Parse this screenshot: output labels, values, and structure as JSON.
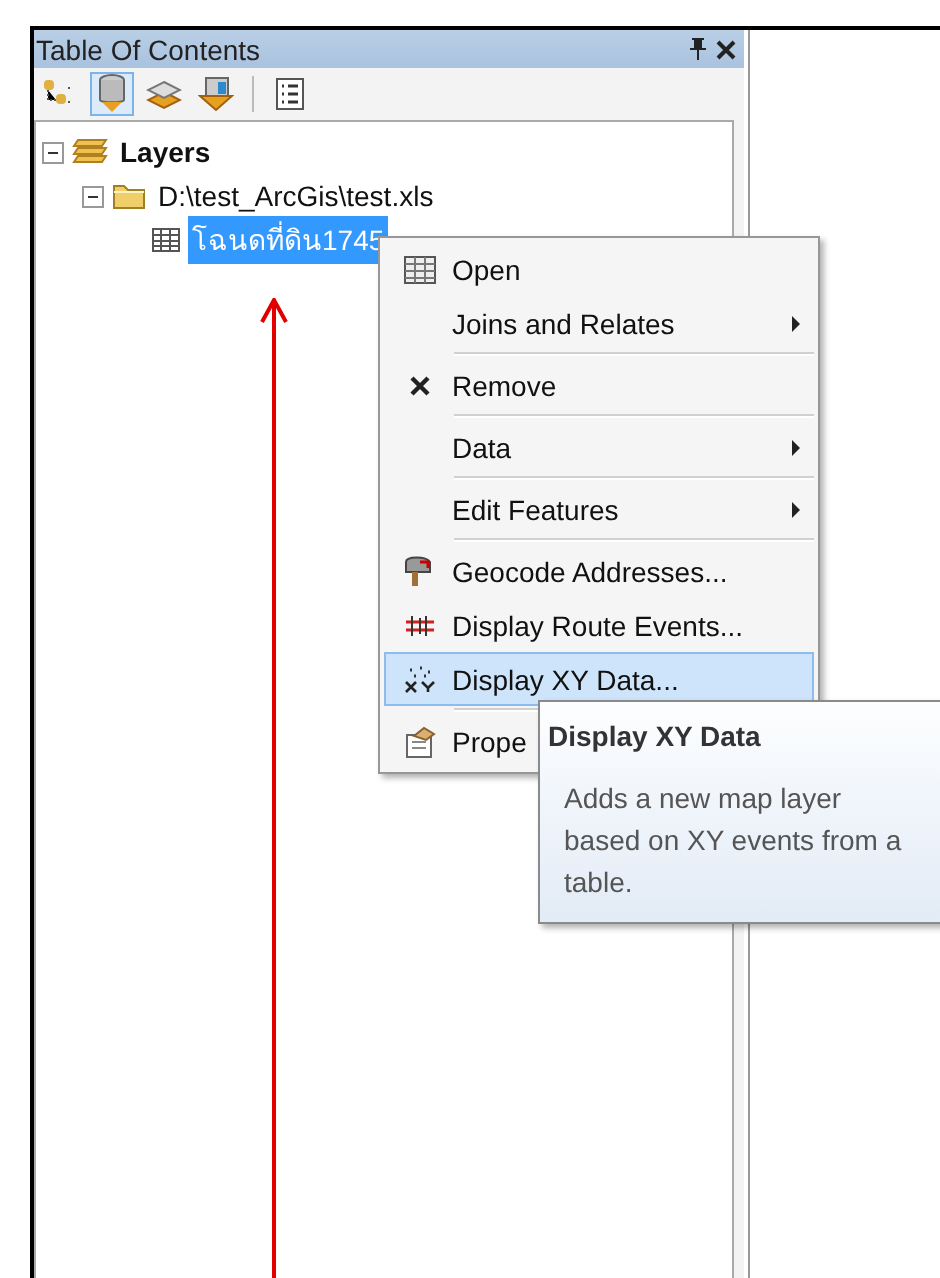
{
  "panel": {
    "title": "Table Of Contents"
  },
  "toolbar": [
    {
      "selected": false
    },
    {
      "selected": true
    },
    {
      "selected": false
    },
    {
      "selected": false
    },
    {
      "selected": false
    }
  ],
  "tree": [
    {
      "label": "Layers",
      "kind": "frame",
      "expanded": true,
      "selected": false,
      "children": [
        {
          "label": "D:\\test_ArcGis\\test.xls",
          "kind": "folder",
          "expanded": true,
          "selected": false,
          "children": [
            {
              "label": "โฉนดที่ดิน1745",
              "kind": "table",
              "selected": true
            }
          ]
        }
      ]
    }
  ],
  "context_menu": [
    {
      "kind": "item",
      "icon": true,
      "label": "Open",
      "submenu": false,
      "selected": false
    },
    {
      "kind": "item",
      "icon": false,
      "label": "Joins and Relates",
      "submenu": true,
      "selected": false
    },
    {
      "kind": "separator"
    },
    {
      "kind": "item",
      "icon": true,
      "label": "Remove",
      "submenu": false,
      "selected": false
    },
    {
      "kind": "separator"
    },
    {
      "kind": "item",
      "icon": false,
      "label": "Data",
      "submenu": true,
      "selected": false
    },
    {
      "kind": "separator"
    },
    {
      "kind": "item",
      "icon": false,
      "label": "Edit Features",
      "submenu": true,
      "selected": false
    },
    {
      "kind": "separator"
    },
    {
      "kind": "item",
      "icon": true,
      "label": "Geocode Addresses...",
      "submenu": false,
      "selected": false
    },
    {
      "kind": "item",
      "icon": true,
      "label": "Display Route Events...",
      "submenu": false,
      "selected": false
    },
    {
      "kind": "item",
      "icon": true,
      "label": "Display XY Data...",
      "submenu": false,
      "selected": true
    },
    {
      "kind": "separator"
    },
    {
      "kind": "item",
      "icon": true,
      "label": "Prope",
      "submenu": false,
      "selected": false
    }
  ],
  "tooltip": {
    "title": "Display XY Data",
    "body": "Adds a new map layer based on XY events from a table."
  }
}
